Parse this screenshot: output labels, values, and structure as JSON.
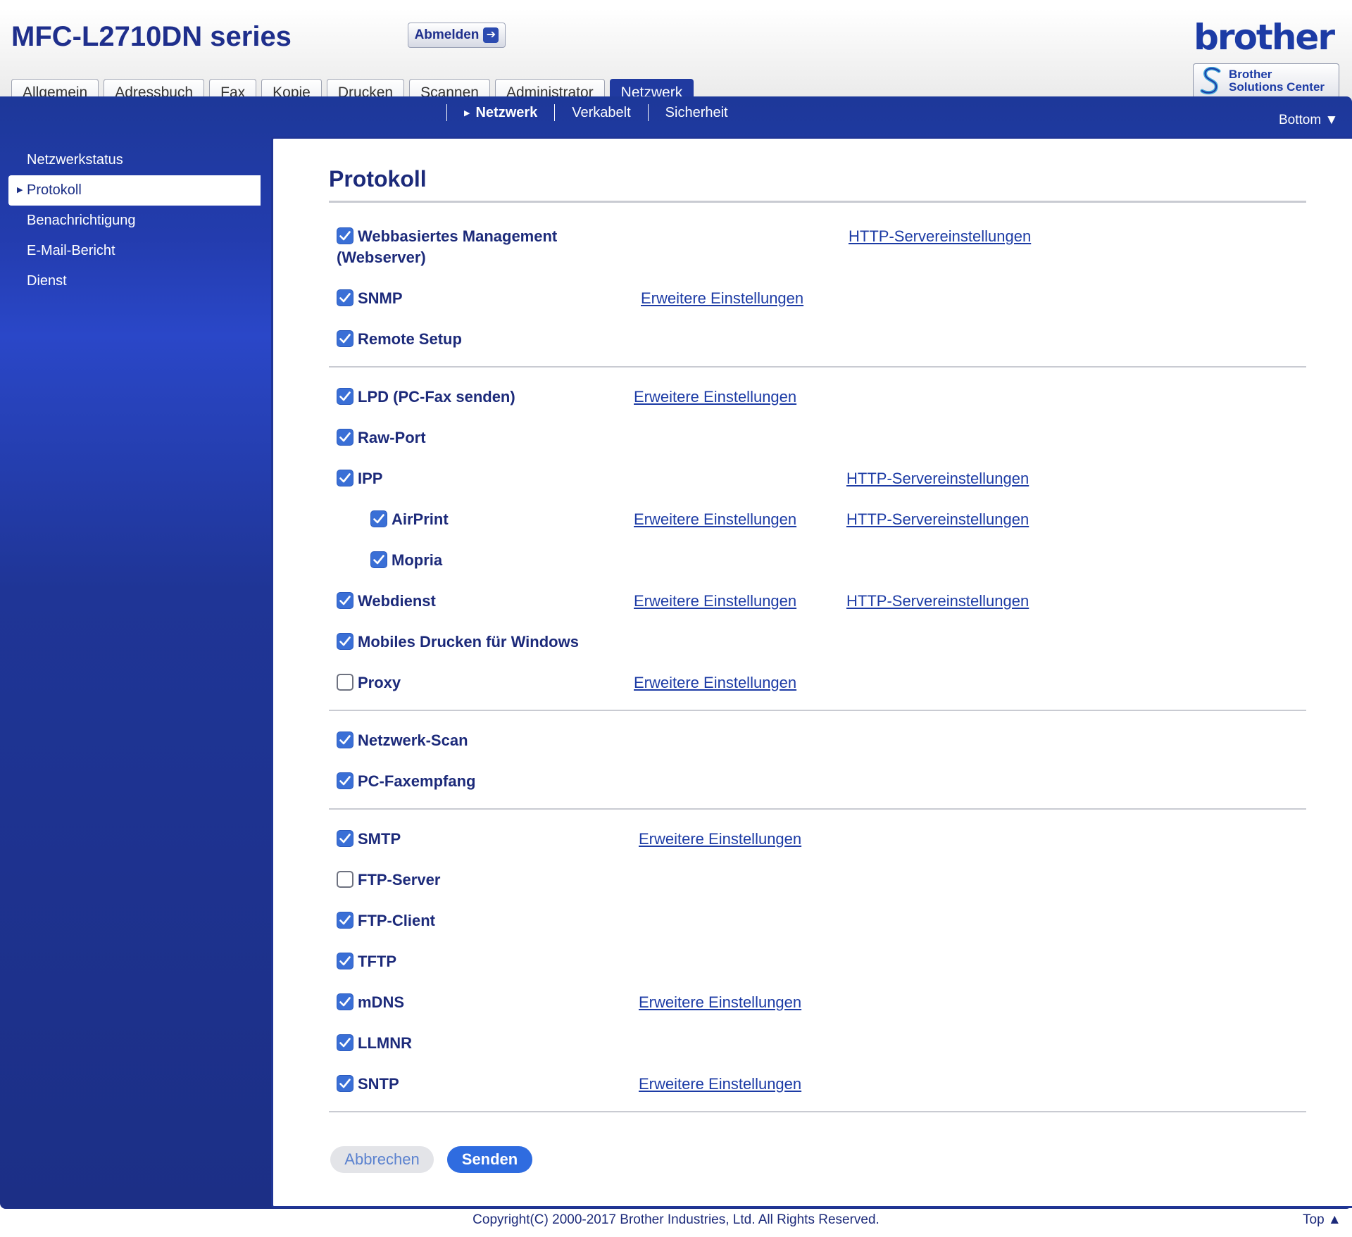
{
  "header": {
    "model": "MFC-L2710DN series",
    "logout_label": "Abmelden",
    "brand": "brother",
    "solutions_line1": "Brother",
    "solutions_line2": "Solutions Center"
  },
  "tabs": [
    {
      "label": "Allgemein",
      "active": false
    },
    {
      "label": "Adressbuch",
      "active": false
    },
    {
      "label": "Fax",
      "active": false
    },
    {
      "label": "Kopie",
      "active": false
    },
    {
      "label": "Drucken",
      "active": false
    },
    {
      "label": "Scannen",
      "active": false
    },
    {
      "label": "Administrator",
      "active": false
    },
    {
      "label": "Netzwerk",
      "active": true
    }
  ],
  "subnav": [
    {
      "label": "Netzwerk",
      "active": true
    },
    {
      "label": "Verkabelt",
      "active": false
    },
    {
      "label": "Sicherheit",
      "active": false
    }
  ],
  "bottom_link": "Bottom ▼",
  "sidebar": [
    {
      "label": "Netzwerkstatus",
      "active": false
    },
    {
      "label": "Protokoll",
      "active": true
    },
    {
      "label": "Benachrichtigung",
      "active": false
    },
    {
      "label": "E-Mail-Bericht",
      "active": false
    },
    {
      "label": "Dienst",
      "active": false
    }
  ],
  "main": {
    "title": "Protokoll",
    "link_http": "HTTP-Servereinstellungen",
    "link_advanced": "Erweitere Einstellungen",
    "groups": [
      [
        {
          "label": "Webbasiertes Management (Webserver)",
          "checked": true,
          "links": [
            "http"
          ]
        },
        {
          "label": "SNMP",
          "checked": true,
          "links": [
            "advanced"
          ]
        },
        {
          "label": "Remote Setup",
          "checked": true,
          "links": []
        }
      ],
      [
        {
          "label": "LPD (PC-Fax senden)",
          "checked": true,
          "links": [
            "advanced"
          ]
        },
        {
          "label": "Raw-Port",
          "checked": true,
          "links": []
        },
        {
          "label": "IPP",
          "checked": true,
          "links": [
            "http"
          ]
        },
        {
          "label": "AirPrint",
          "checked": true,
          "links": [
            "advanced",
            "http"
          ]
        },
        {
          "label": "Mopria",
          "checked": true,
          "links": []
        },
        {
          "label": "Webdienst",
          "checked": true,
          "links": [
            "advanced",
            "http"
          ]
        },
        {
          "label": "Mobiles Drucken für Windows",
          "checked": true,
          "links": []
        },
        {
          "label": "Proxy",
          "checked": false,
          "links": [
            "advanced"
          ]
        }
      ],
      [
        {
          "label": "Netzwerk-Scan",
          "checked": true,
          "links": []
        },
        {
          "label": "PC-Faxempfang",
          "checked": true,
          "links": []
        }
      ],
      [
        {
          "label": "SMTP",
          "checked": true,
          "links": [
            "advanced"
          ]
        },
        {
          "label": "FTP-Server",
          "checked": false,
          "links": []
        },
        {
          "label": "FTP-Client",
          "checked": true,
          "links": []
        },
        {
          "label": "TFTP",
          "checked": true,
          "links": []
        },
        {
          "label": "mDNS",
          "checked": true,
          "links": [
            "advanced"
          ]
        },
        {
          "label": "LLMNR",
          "checked": true,
          "links": []
        },
        {
          "label": "SNTP",
          "checked": true,
          "links": [
            "advanced"
          ]
        }
      ]
    ],
    "cancel_label": "Abbrechen",
    "send_label": "Senden"
  },
  "footer": {
    "copyright": "Copyright(C) 2000-2017 Brother Industries, Ltd. All Rights Reserved.",
    "top_link": "Top ▲"
  },
  "colors": {
    "nav_blue": "#1f3596",
    "checkbox_blue": "#3a6fd6",
    "send_button": "#2f6ce0"
  }
}
